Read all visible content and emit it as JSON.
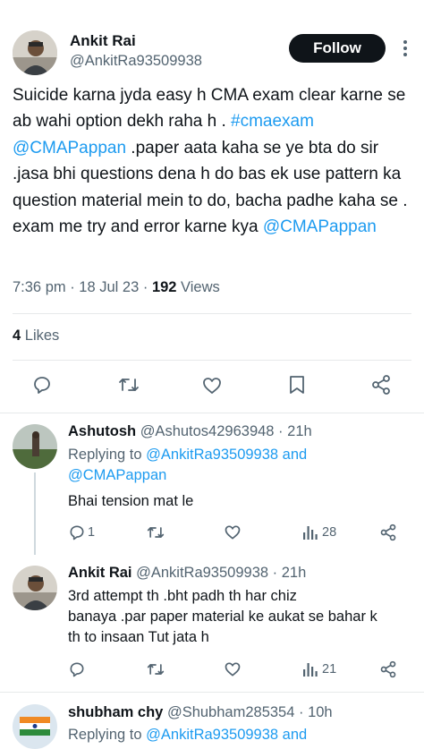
{
  "main_tweet": {
    "author_name": "Ankit Rai",
    "handle": "@AnkitRa93509938",
    "follow_label": "Follow",
    "text_parts": [
      {
        "t": "Suicide karna jyda easy h CMA exam clear karne se ab wahi option dekh raha h . ",
        "link": false
      },
      {
        "t": "#cmaexam",
        "link": true
      },
      {
        "t": " ",
        "link": false
      },
      {
        "t": "@CMAPappan",
        "link": true
      },
      {
        "t": " .paper aata kaha se ye bta do sir .jasa bhi questions dena h do bas ek use pattern ka question material mein to do, bacha padhe kaha se . exam me try and error karne kya ",
        "link": false
      },
      {
        "t": "@CMAPappan",
        "link": true
      }
    ],
    "time": "7:36 pm",
    "separator": " · ",
    "date": "18 Jul 23",
    "views_count": "192",
    "views_label": " Views",
    "likes_count": "4",
    "likes_label": " Likes"
  },
  "actions": {
    "icons": [
      "reply-icon",
      "retweet-icon",
      "like-icon",
      "bookmark-icon",
      "share-icon"
    ]
  },
  "replies": [
    {
      "name": "Ashutosh",
      "handle": "@Ashutos42963948",
      "dot": " · ",
      "time": "21h",
      "replying_to_label": "Replying to ",
      "replying_to_1": "@AnkitRa93509938",
      "replying_and": " and",
      "replying_to_2": "@CMAPappan",
      "text": "Bhai tension mat le",
      "reply_count": "1",
      "views": "28"
    },
    {
      "name": "Ankit Rai",
      "handle": "@AnkitRa93509938",
      "dot": " · ",
      "time": "21h",
      "text_line_1": "3rd attempt th .bht padh th har chiz",
      "text_line_2": "banaya .par paper material ke aukat se bahar k",
      "text_line_3": "th to insaan Tut jata h",
      "views": "21"
    },
    {
      "name": "shubham chy",
      "handle": "@Shubham285354",
      "dot": " · ",
      "time": "10h",
      "replying_to_label": "Replying to ",
      "replying_to_1": "@AnkitRa93509938",
      "replying_and": " and"
    }
  ],
  "colors": {
    "link": "#1d9bf0",
    "muted": "#536471",
    "text": "#0f1419",
    "divider": "#e6e9ea"
  }
}
